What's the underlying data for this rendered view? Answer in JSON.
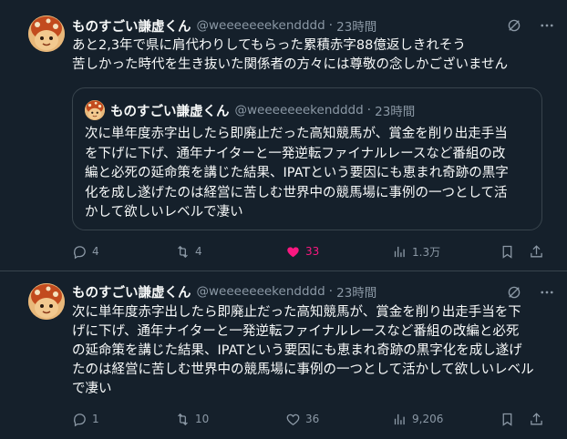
{
  "tweets": [
    {
      "author": {
        "name": "ものすごい謙虚くん",
        "handle": "@weeeeeeekendddd",
        "time": "23時間"
      },
      "text_lines": [
        "あと2,3年で県に肩代わりしてもらった累積赤字88億返しきれそう",
        "苦しかった時代を生き抜いた関係者の方々には尊敬の念しかございません"
      ],
      "quote": {
        "author": {
          "name": "ものすごい謙虚くん",
          "handle": "@weeeeeeekendddd",
          "time": "23時間"
        },
        "text_lines": [
          "次に単年度赤字出したら即廃止だった高知競馬が、賞金を削り出走手当",
          "を下げに下げ、通年ナイターと一発逆転ファイナルレースなど番組の改",
          "編と必死の延命策を講じた結果、IPATという要因にも恵まれ奇跡の黒字",
          "化を成し遂げたのは経営に苦しむ世界中の競馬場に事例の一つとして活",
          "かして欲しいレベルで凄い"
        ]
      },
      "actions": {
        "replies": "4",
        "retweets": "4",
        "likes": "33",
        "views": "1.3万"
      },
      "liked": true
    },
    {
      "author": {
        "name": "ものすごい謙虚くん",
        "handle": "@weeeeeeekendddd",
        "time": "23時間"
      },
      "text_lines": [
        "次に単年度赤字出したら即廃止だった高知競馬が、賞金を削り出走手当を下",
        "げに下げ、通年ナイターと一発逆転ファイナルレースなど番組の改編と必死",
        "の延命策を講じた結果、IPATという要因にも恵まれ奇跡の黒字化を成し遂げ",
        "たのは経営に苦しむ世界中の競馬場に事例の一つとして活かして欲しいレベル",
        "で凄い"
      ],
      "actions": {
        "replies": "1",
        "retweets": "10",
        "likes": "36",
        "views": "9,206"
      },
      "liked": false
    }
  ],
  "separator": "·",
  "colors": {
    "background": "#15202b",
    "border": "#38444d",
    "text": "#f7f9f9",
    "muted": "#8b98a5",
    "like": "#f91880"
  },
  "icons": [
    "grok-icon",
    "more-icon",
    "reply-icon",
    "retweet-icon",
    "heart-icon",
    "views-icon",
    "bookmark-icon",
    "share-icon"
  ]
}
